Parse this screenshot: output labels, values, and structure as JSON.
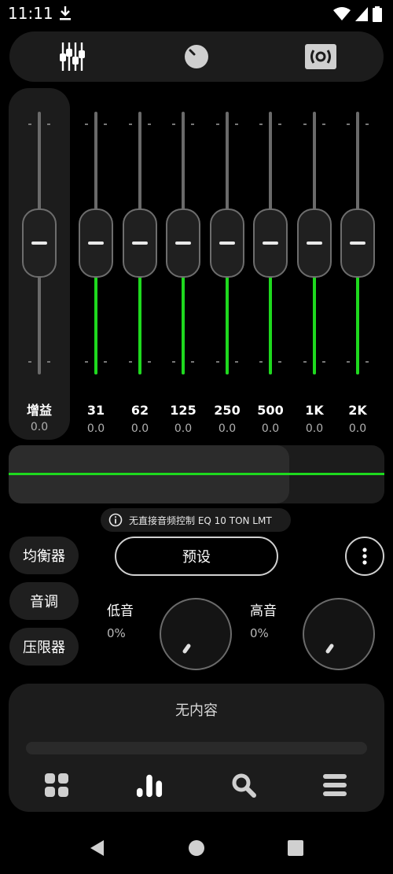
{
  "status": {
    "time": "11:11",
    "download_icon": "download-icon",
    "wifi_icon": "wifi-icon",
    "signal_icon": "signal-icon",
    "battery_icon": "battery-icon"
  },
  "top_tabs": [
    {
      "name": "equalizer-sliders-icon",
      "active": true
    },
    {
      "name": "knob-icon",
      "active": false
    },
    {
      "name": "speaker-icon",
      "active": false
    }
  ],
  "gain": {
    "label": "增益",
    "value": "0.0",
    "level": 0.5
  },
  "bands": [
    {
      "label": "31",
      "value": "0.0",
      "level": 0.5
    },
    {
      "label": "62",
      "value": "0.0",
      "level": 0.5
    },
    {
      "label": "125",
      "value": "0.0",
      "level": 0.5
    },
    {
      "label": "250",
      "value": "0.0",
      "level": 0.5
    },
    {
      "label": "500",
      "value": "0.0",
      "level": 0.5
    },
    {
      "label": "1K",
      "value": "0.0",
      "level": 0.5
    },
    {
      "label": "2K",
      "value": "0.0",
      "level": 0.5
    }
  ],
  "info": {
    "text": "无直接音频控制 EQ 10 TON LMT",
    "icon": "info-icon"
  },
  "side_buttons": [
    "均衡器",
    "音调",
    "压限器"
  ],
  "preset_label": "预设",
  "more_icon": "more-vertical-icon",
  "tone": {
    "bass_label": "低音",
    "bass_value": "0%",
    "treble_label": "高音",
    "treble_value": "0%"
  },
  "player": {
    "title": "无内容",
    "nav": [
      "grid-icon",
      "bars-icon",
      "search-icon",
      "menu-icon"
    ]
  },
  "system_nav": [
    "back-icon",
    "home-icon",
    "recents-icon"
  ],
  "colors": {
    "accent": "#1ed91e",
    "panel": "#1c1c1c",
    "background": "#000000"
  }
}
